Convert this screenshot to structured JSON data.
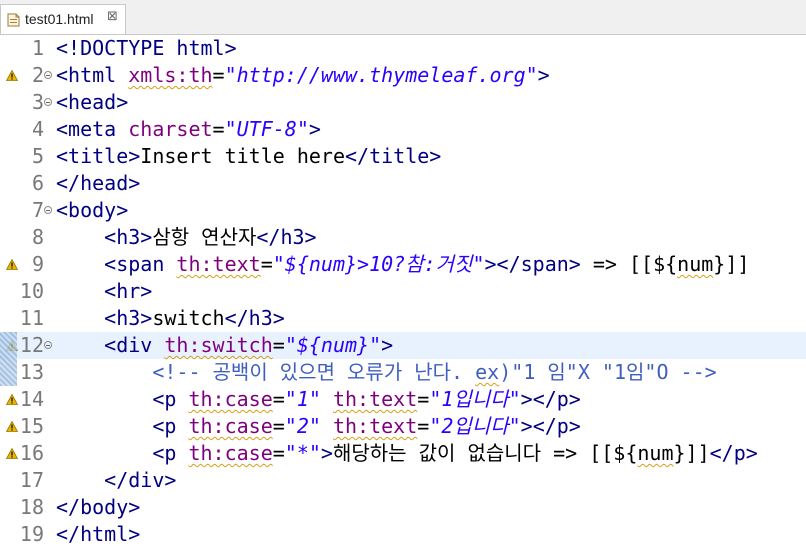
{
  "tab": {
    "title": "test01.html",
    "close_symbol": "⊠"
  },
  "lines": [
    {
      "n": "1",
      "warn": false,
      "fold": false,
      "active": false,
      "tokens": [
        [
          "t",
          "<!DOCTYPE html>"
        ]
      ]
    },
    {
      "n": "2",
      "warn": true,
      "fold": true,
      "active": false,
      "tokens": [
        [
          "t",
          "<html "
        ],
        [
          "an",
          "xmls:th",
          "w"
        ],
        [
          "tx",
          "="
        ],
        [
          "av",
          "\"http://www.thymeleaf.org\""
        ],
        [
          "t",
          ">"
        ]
      ]
    },
    {
      "n": "3",
      "warn": false,
      "fold": true,
      "active": false,
      "tokens": [
        [
          "t",
          "<head>"
        ]
      ]
    },
    {
      "n": "4",
      "warn": false,
      "fold": false,
      "active": false,
      "tokens": [
        [
          "t",
          "<meta "
        ],
        [
          "an",
          "charset"
        ],
        [
          "tx",
          "="
        ],
        [
          "av",
          "\"UTF-8\""
        ],
        [
          "t",
          ">"
        ]
      ]
    },
    {
      "n": "5",
      "warn": false,
      "fold": false,
      "active": false,
      "tokens": [
        [
          "t",
          "<title>"
        ],
        [
          "tx",
          "Insert title here"
        ],
        [
          "t",
          "</title>"
        ]
      ]
    },
    {
      "n": "6",
      "warn": false,
      "fold": false,
      "active": false,
      "tokens": [
        [
          "t",
          "</head>"
        ]
      ]
    },
    {
      "n": "7",
      "warn": false,
      "fold": true,
      "active": false,
      "tokens": [
        [
          "t",
          "<body>"
        ]
      ]
    },
    {
      "n": "8",
      "warn": false,
      "fold": false,
      "active": false,
      "tokens": [
        [
          "tx",
          "    "
        ],
        [
          "t",
          "<h3>"
        ],
        [
          "tx",
          "삼항 연산자"
        ],
        [
          "t",
          "</h3>"
        ]
      ]
    },
    {
      "n": "9",
      "warn": true,
      "fold": false,
      "active": false,
      "tokens": [
        [
          "tx",
          "    "
        ],
        [
          "t",
          "<span "
        ],
        [
          "an",
          "th:text",
          "w"
        ],
        [
          "tx",
          "="
        ],
        [
          "av",
          "\"${num}>10?참:거짓\""
        ],
        [
          "t",
          ">"
        ],
        [
          "t",
          "</span>"
        ],
        [
          "tx",
          " => [[${"
        ],
        [
          "tx",
          "num",
          "w"
        ],
        [
          "tx",
          "}]]"
        ]
      ]
    },
    {
      "n": "10",
      "warn": false,
      "fold": false,
      "active": false,
      "tokens": [
        [
          "tx",
          "    "
        ],
        [
          "t",
          "<hr>"
        ]
      ]
    },
    {
      "n": "11",
      "warn": false,
      "fold": false,
      "active": false,
      "tokens": [
        [
          "tx",
          "    "
        ],
        [
          "t",
          "<h3>"
        ],
        [
          "tx",
          "switch"
        ],
        [
          "t",
          "</h3>"
        ]
      ]
    },
    {
      "n": "12",
      "warn": true,
      "fold": true,
      "active": true,
      "tokens": [
        [
          "tx",
          "    "
        ],
        [
          "t",
          "<div "
        ],
        [
          "an",
          "th:switch",
          "w"
        ],
        [
          "tx",
          "="
        ],
        [
          "av",
          "\"${num}\""
        ],
        [
          "t",
          ">"
        ]
      ]
    },
    {
      "n": "13",
      "warn": false,
      "fold": false,
      "active": false,
      "tokens": [
        [
          "tx",
          "        "
        ],
        [
          "cm",
          "<!-- 공백이 있으면 오류가 난다. "
        ],
        [
          "cm",
          "ex",
          "w"
        ],
        [
          "cm",
          ")\"1 임\"X \"1임\"O -->"
        ]
      ]
    },
    {
      "n": "14",
      "warn": true,
      "fold": false,
      "active": false,
      "tokens": [
        [
          "tx",
          "        "
        ],
        [
          "t",
          "<p "
        ],
        [
          "an",
          "th:case",
          "w"
        ],
        [
          "tx",
          "="
        ],
        [
          "av",
          "\"1\""
        ],
        [
          "tx",
          " "
        ],
        [
          "an",
          "th:text",
          "w"
        ],
        [
          "tx",
          "="
        ],
        [
          "av",
          "\"1입니다\""
        ],
        [
          "t",
          ">"
        ],
        [
          "t",
          "</p>"
        ]
      ]
    },
    {
      "n": "15",
      "warn": true,
      "fold": false,
      "active": false,
      "tokens": [
        [
          "tx",
          "        "
        ],
        [
          "t",
          "<p "
        ],
        [
          "an",
          "th:case",
          "w"
        ],
        [
          "tx",
          "="
        ],
        [
          "av",
          "\"2\""
        ],
        [
          "tx",
          " "
        ],
        [
          "an",
          "th:text",
          "w"
        ],
        [
          "tx",
          "="
        ],
        [
          "av",
          "\"2입니다\""
        ],
        [
          "t",
          ">"
        ],
        [
          "t",
          "</p>"
        ]
      ]
    },
    {
      "n": "16",
      "warn": true,
      "fold": false,
      "active": false,
      "tokens": [
        [
          "tx",
          "        "
        ],
        [
          "t",
          "<p "
        ],
        [
          "an",
          "th:case",
          "w"
        ],
        [
          "tx",
          "="
        ],
        [
          "av",
          "\"*\""
        ],
        [
          "t",
          ">"
        ],
        [
          "tx",
          "해당하는 값이 없습니다 => [[${"
        ],
        [
          "tx",
          "num",
          "w"
        ],
        [
          "tx",
          "}]]"
        ],
        [
          "t",
          "</p>"
        ]
      ]
    },
    {
      "n": "17",
      "warn": false,
      "fold": false,
      "active": false,
      "tokens": [
        [
          "tx",
          "    "
        ],
        [
          "t",
          "</div>"
        ]
      ]
    },
    {
      "n": "18",
      "warn": false,
      "fold": false,
      "active": false,
      "tokens": [
        [
          "t",
          "</body>"
        ]
      ]
    },
    {
      "n": "19",
      "warn": false,
      "fold": false,
      "active": false,
      "tokens": [
        [
          "t",
          "</html>"
        ]
      ]
    }
  ],
  "colors": {
    "tag": "#000080",
    "attr_name": "#7f007f",
    "attr_value": "#2a00ff",
    "comment": "#3f5fbf",
    "line_number": "#787878",
    "current_line": "#e8f2fe",
    "warning": "#e8b500"
  }
}
